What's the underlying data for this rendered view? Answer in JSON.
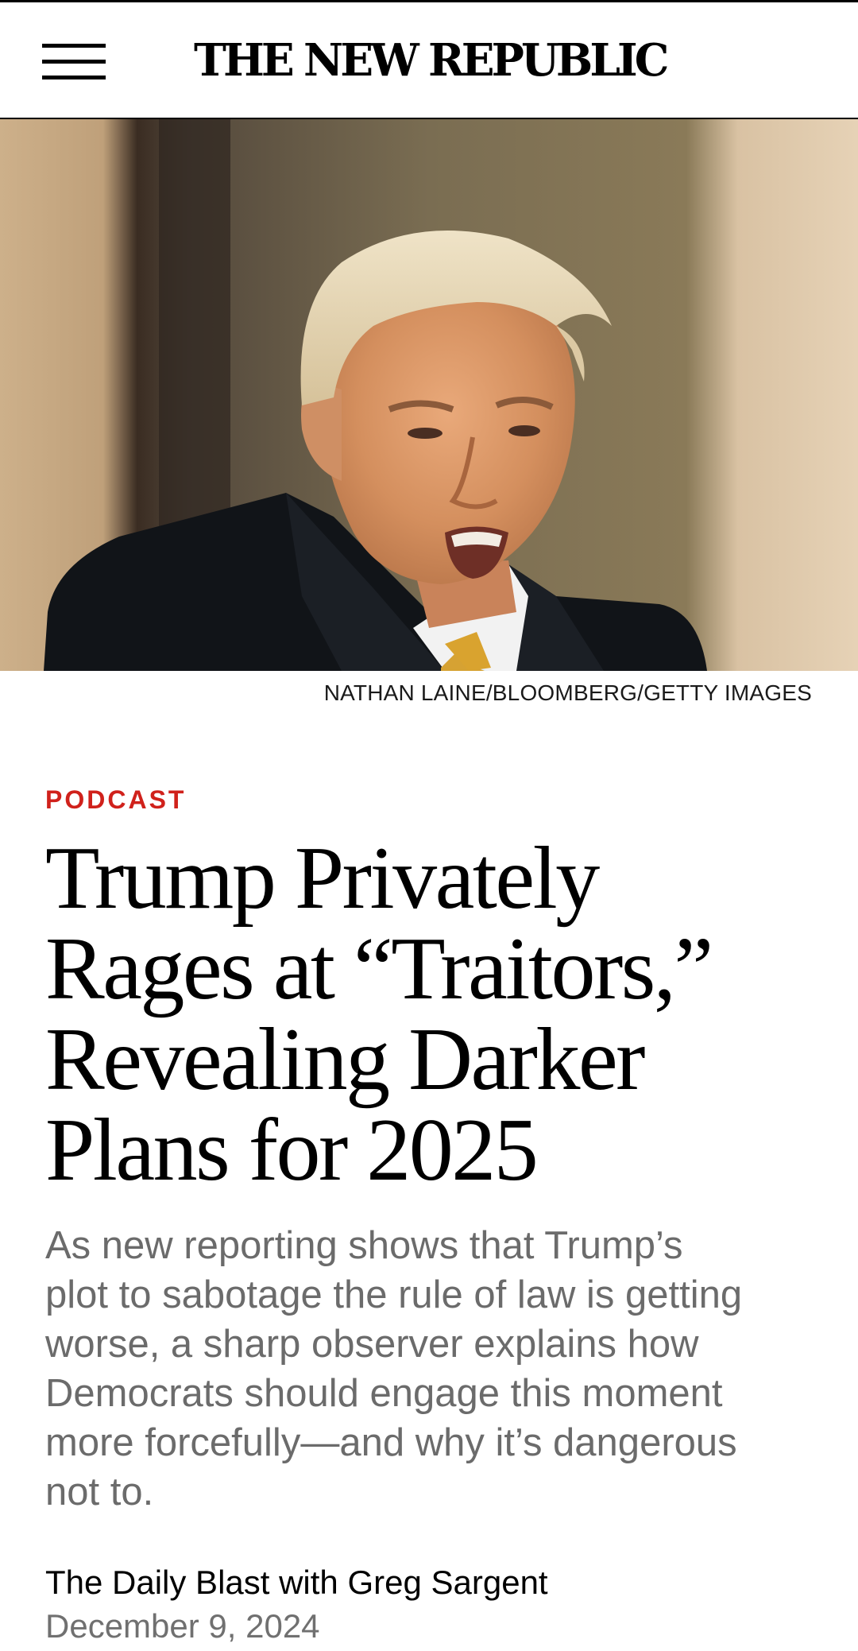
{
  "header": {
    "logo_text": "THE NEW REPUBLIC",
    "menu_icon": "hamburger-menu-icon"
  },
  "hero": {
    "photo_credit": "NATHAN LAINE/BLOOMBERG/GETTY IMAGES"
  },
  "article": {
    "section": "PODCAST",
    "headline_lines": [
      "Trump Privately",
      "Rages at “Traitors,”",
      "Revealing Darker",
      "Plans for 2025"
    ],
    "dek_lines": [
      "As new reporting shows that Trump’s",
      "plot to sabotage the rule of law is getting",
      "worse, a sharp observer explains how",
      "Democrats should engage this moment",
      "more forcefully—and why it’s dangerous",
      "not to."
    ],
    "byline": "The Daily Blast with Greg Sargent",
    "date": "December 9, 2024"
  },
  "colors": {
    "kicker": "#d0211b",
    "dek": "#6b6b6b",
    "date": "#707070",
    "text": "#000000"
  }
}
